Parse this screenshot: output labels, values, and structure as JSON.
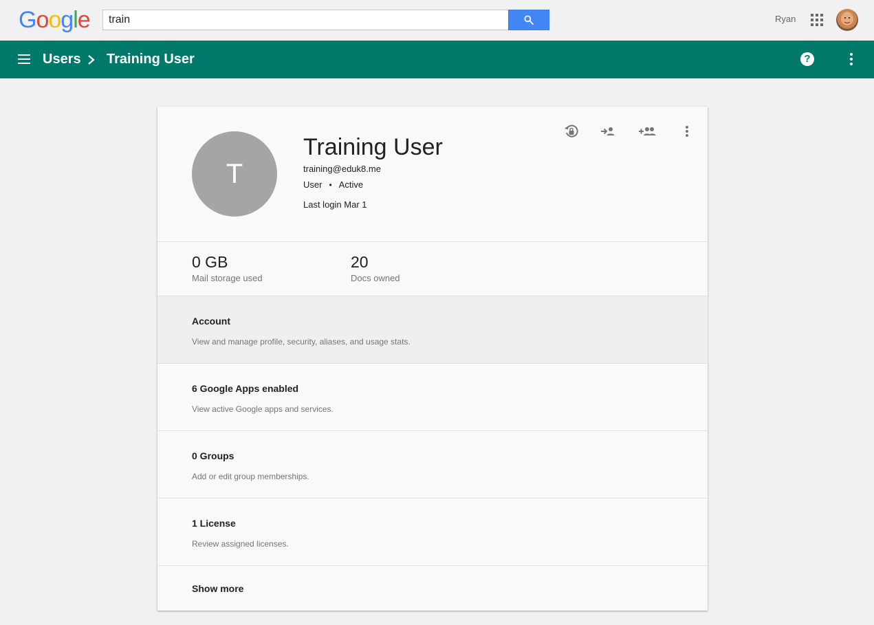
{
  "topbar": {
    "logo_letters": [
      {
        "char": "G",
        "color": "#4285f4"
      },
      {
        "char": "o",
        "color": "#ea4335"
      },
      {
        "char": "o",
        "color": "#fbbc05"
      },
      {
        "char": "g",
        "color": "#4285f4"
      },
      {
        "char": "l",
        "color": "#34a853"
      },
      {
        "char": "e",
        "color": "#ea4335"
      }
    ],
    "search_value": "train",
    "search_icon": "search-icon",
    "user_name": "Ryan",
    "apps_icon": "apps-grid-icon",
    "avatar": "user-photo"
  },
  "appbar": {
    "color": "#00796b",
    "menu_icon": "menu-icon",
    "breadcrumb_parent": "Users",
    "breadcrumb_current": "Training User",
    "help_icon": "help-icon",
    "more_icon": "more-vert-icon"
  },
  "profile": {
    "avatar_letter": "T",
    "name": "Training User",
    "email": "training@eduk8.me",
    "role": "User",
    "separator": "•",
    "status": "Active",
    "last_login": "Last login Mar 1",
    "actions": [
      "reset-password-icon",
      "sign-in-icon",
      "add-to-group-icon",
      "more-vert-icon"
    ]
  },
  "stats": [
    {
      "value": "0 GB",
      "label": "Mail storage used"
    },
    {
      "value": "20",
      "label": "Docs owned"
    }
  ],
  "sections": [
    {
      "title": "Account",
      "desc": "View and manage profile, security, aliases, and usage stats."
    },
    {
      "title": "6 Google Apps enabled",
      "desc": "View active Google apps and services."
    },
    {
      "title": "0 Groups",
      "desc": "Add or edit group memberships."
    },
    {
      "title": "1 License",
      "desc": "Review assigned licenses."
    }
  ],
  "show_more": "Show more"
}
